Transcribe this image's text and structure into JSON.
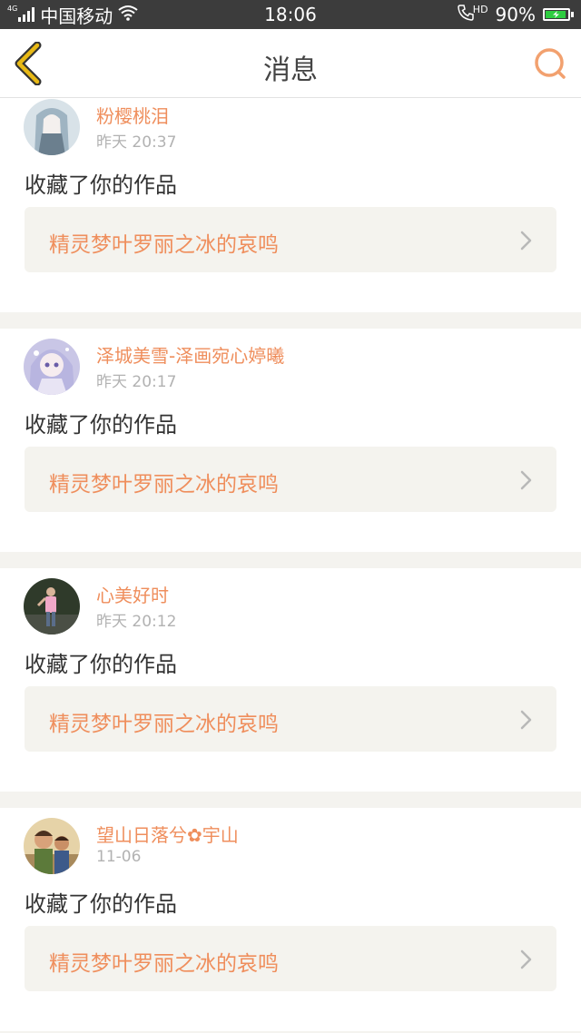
{
  "status_bar": {
    "network": "4G",
    "carrier": "中国移动",
    "time": "18:06",
    "call_badge": "HD",
    "battery_percent": "90%",
    "battery_level": 0.9,
    "icons": [
      "signal-icon",
      "wifi-icon",
      "phone-hd-icon",
      "battery-charging-icon"
    ]
  },
  "header": {
    "title": "消息",
    "back_icon": "chevron-left-icon",
    "search_icon": "search-icon"
  },
  "notifications": [
    {
      "username": "粉樱桃泪",
      "time": "昨天 20:37",
      "action": "收藏了你的作品",
      "work_title": "精灵梦叶罗丽之冰的哀鸣"
    },
    {
      "username": "泽城美雪-泽画宛心婷曦",
      "time": "昨天 20:17",
      "action": "收藏了你的作品",
      "work_title": "精灵梦叶罗丽之冰的哀鸣"
    },
    {
      "username": "心美好时",
      "time": "昨天 20:12",
      "action": "收藏了你的作品",
      "work_title": "精灵梦叶罗丽之冰的哀鸣"
    },
    {
      "username": "望山日落兮✿宇山",
      "time": "11-06",
      "action": "收藏了你的作品",
      "work_title": "精灵梦叶罗丽之冰的哀鸣"
    }
  ],
  "colors": {
    "accent": "#ef8e5c",
    "back_arrow": "#e8b915",
    "background": "#f4f3ef",
    "status_bar": "#3c3c3c"
  }
}
